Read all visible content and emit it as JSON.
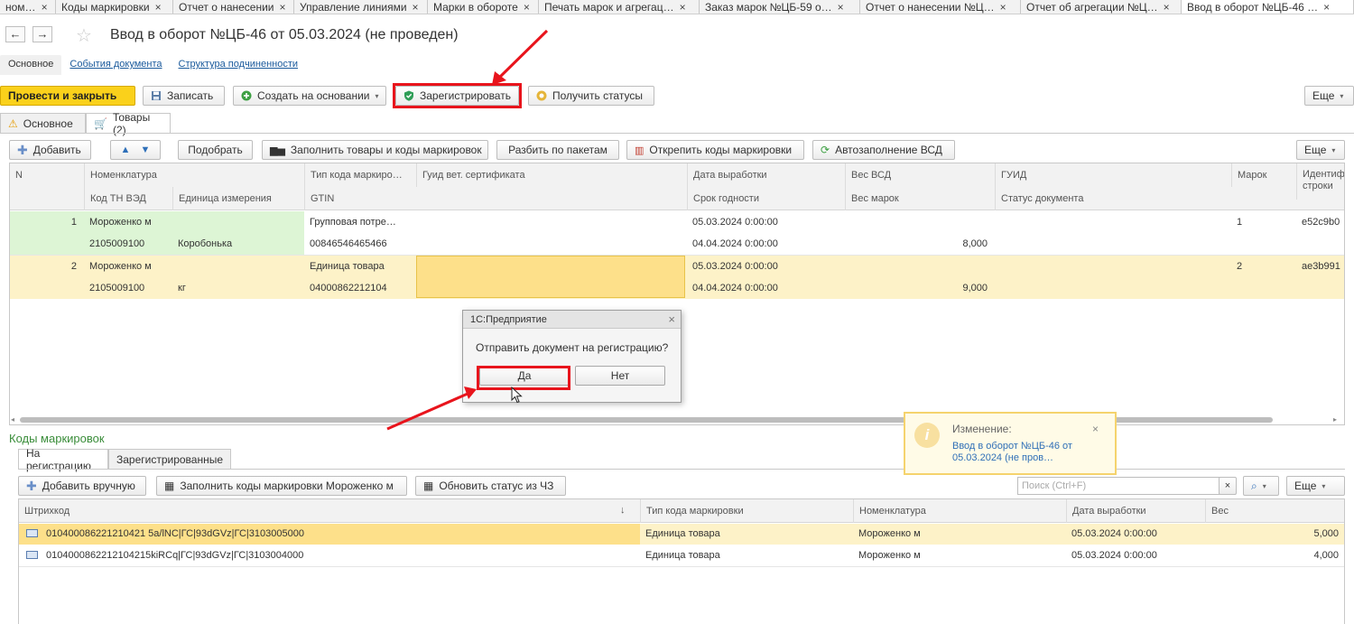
{
  "window_tabs": [
    {
      "label": "ном…",
      "active": false
    },
    {
      "label": "Коды маркировки",
      "active": false
    },
    {
      "label": "Отчет о нанесении",
      "active": false
    },
    {
      "label": "Управление линиями",
      "active": false
    },
    {
      "label": "Марки в обороте",
      "active": false
    },
    {
      "label": "Печать марок и агрегац…",
      "active": false
    },
    {
      "label": "Заказ марок №ЦБ-59 о…",
      "active": false
    },
    {
      "label": "Отчет о нанесении №Ц…",
      "active": false
    },
    {
      "label": "Отчет об агрегации №Ц…",
      "active": false
    },
    {
      "label": "Ввод в оборот №ЦБ-46 …",
      "active": true
    }
  ],
  "tab_close": "×",
  "header": {
    "back": "←",
    "forward": "→",
    "star": "☆",
    "title": "Ввод в оборот №ЦБ-46 от 05.03.2024 (не проведен)"
  },
  "form_tabs": [
    "Основное",
    "События документа",
    "Структура подчиненности"
  ],
  "toolbar": {
    "post_close": "Провести и закрыть",
    "save": "Записать",
    "create_based": "Создать на основании",
    "register": "Зарегистрировать",
    "get_statuses": "Получить статусы",
    "more": "Еще"
  },
  "sub_tabs": [
    "Основное",
    "Товары (2)"
  ],
  "goods_toolbar": {
    "add": "Добавить",
    "pick": "Подобрать",
    "fill": "Заполнить товары и коды маркировок",
    "split": "Разбить по пакетам",
    "detach": "Открепить коды маркировки",
    "autofill": "Автозаполнение ВСД",
    "more": "Еще"
  },
  "goods_headers": {
    "n": "N",
    "nomenclature": "Номенклатура",
    "tnved": "Код ТН ВЭД",
    "unit": "Единица измерения",
    "code_type": "Тип кода маркиро…",
    "gtin": "GTIN",
    "vet_guid": "Гуид вет. сертификата",
    "prod_date": "Дата выработки",
    "expiry": "Срок годности",
    "vsd_weight": "Вес ВСД",
    "marks_weight": "Вес марок",
    "guid": "ГУИД",
    "doc_status": "Статус документа",
    "marks": "Марок",
    "row_id": "Идентиф строки"
  },
  "goods_rows": [
    {
      "n": "1",
      "nomenclature": "Мороженко м",
      "tnved": "2105009100",
      "unit": "Коробонька",
      "code_type": "Групповая потре…",
      "gtin": "00846546465466",
      "prod_date": "05.03.2024 0:00:00",
      "expiry": "04.04.2024 0:00:00",
      "marks_weight": "8,000",
      "marks": "1",
      "row_id": "e52c9b0"
    },
    {
      "n": "2",
      "nomenclature": "Мороженко м",
      "tnved": "2105009100",
      "unit": "кг",
      "code_type": "Единица товара",
      "gtin": "04000862212104",
      "prod_date": "05.03.2024 0:00:00",
      "expiry": "04.04.2024 0:00:00",
      "marks_weight": "9,000",
      "marks": "2",
      "row_id": "ae3b991"
    }
  ],
  "dialog": {
    "title": "1С:Предприятие",
    "message": "Отправить документ на регистрацию?",
    "yes": "Да",
    "no": "Нет",
    "close": "×"
  },
  "codes_section": {
    "label": "Коды маркировок",
    "tabs": [
      "На регистрацию",
      "Зарегистрированные"
    ],
    "add_manual": "Добавить вручную",
    "fill_codes": "Заполнить коды маркировки Мороженко м",
    "update_status": "Обновить статус из ЧЗ",
    "search_placeholder": "Поиск (Ctrl+F)",
    "more": "Еще",
    "headers": {
      "barcode": "Штрихкод",
      "sort": "↓",
      "code_type": "Тип кода маркировки",
      "nomenclature": "Номенклатура",
      "prod_date": "Дата выработки",
      "weight": "Вес"
    },
    "rows": [
      {
        "barcode": "010400086221210421 5a/lNC|ГС|93dGVz|ГС|3103005000",
        "code_type": "Единица товара",
        "nomenclature": "Мороженко м",
        "prod_date": "05.03.2024 0:00:00",
        "weight": "5,000"
      },
      {
        "barcode": "0104000862212104215kiRCq|ГС|93dGVz|ГС|3103004000",
        "code_type": "Единица товара",
        "nomenclature": "Мороженко м",
        "prod_date": "05.03.2024 0:00:00",
        "weight": "4,000"
      }
    ]
  },
  "toast": {
    "title": "Изменение:",
    "link": "Ввод в оборот №ЦБ-46 от 05.03.2024 (не пров…",
    "close": "×",
    "icon": "i"
  },
  "colors": {
    "accent_yellow": "#fad11b",
    "highlight_red": "#e8141c",
    "row_green": "#ddf5d5",
    "row_yellow": "#fdf2c8",
    "selected_yellow": "#fde08a",
    "link_blue": "#1a5a9c",
    "section_green": "#3a8d3a"
  }
}
